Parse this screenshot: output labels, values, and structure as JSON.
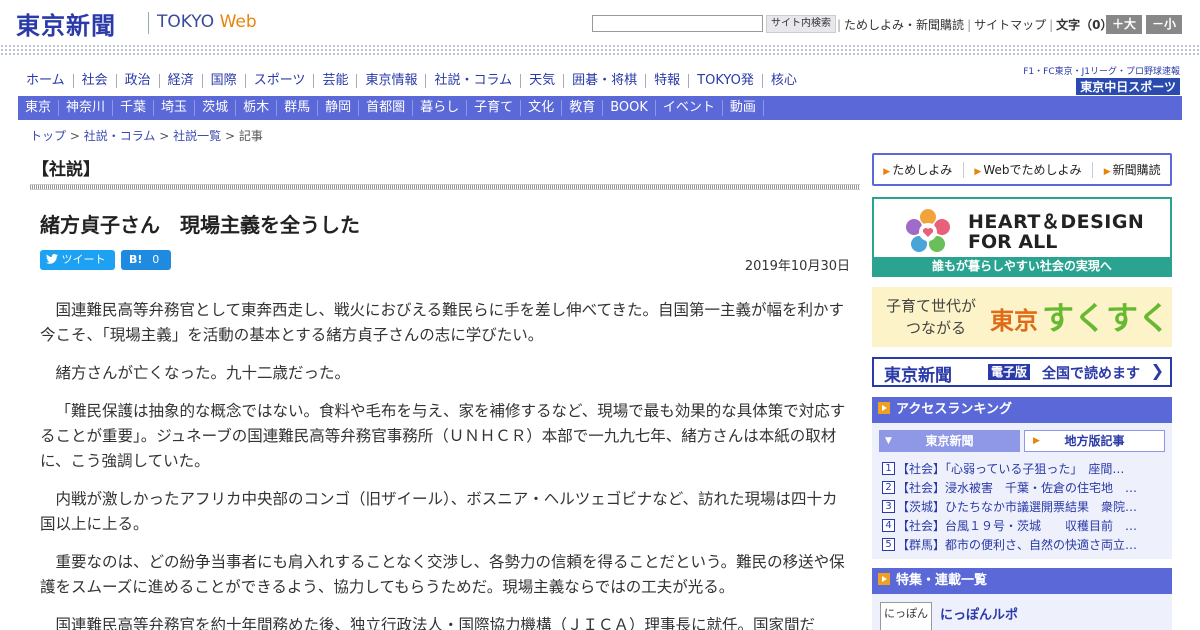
{
  "header": {
    "logo_jp": "東京新聞",
    "logo_en": "TOKYO",
    "logo_web": "Web",
    "search_button": "サイト内検索",
    "links": [
      "ためしよみ・新聞購読",
      "サイトマップ"
    ],
    "font_size_label": "文字（0）",
    "font_larger": "＋大",
    "font_smaller": "－小"
  },
  "main_nav": [
    "ホーム",
    "社会",
    "政治",
    "経済",
    "国際",
    "スポーツ",
    "芸能",
    "東京情報",
    "社説・コラム",
    "天気",
    "囲碁・将棋",
    "特報",
    "TOKYO発",
    "核心"
  ],
  "chunichi": {
    "line1": "F1・FC東京・J1リーグ・プロ野球速報",
    "line2": "東京中日スポーツ"
  },
  "sub_nav": [
    "東京",
    "神奈川",
    "千葉",
    "埼玉",
    "茨城",
    "栃木",
    "群馬",
    "静岡",
    "首都圏",
    "暮らし",
    "子育て",
    "文化",
    "教育",
    "BOOK",
    "イベント",
    "動画"
  ],
  "breadcrumb": {
    "items": [
      "トップ",
      "社説・コラム",
      "社説一覧"
    ],
    "current": "記事",
    "separator": ">"
  },
  "article": {
    "section": "【社説】",
    "headline": "緒方貞子さん　現場主義を全うした",
    "tweet_label": "ツイート",
    "hatena_label": "B!",
    "hatena_count": "0",
    "date": "2019年10月30日",
    "paragraphs": [
      "国連難民高等弁務官として東奔西走し、戦火におびえる難民らに手を差し伸べてきた。自国第一主義が幅を利かす今こそ、「現場主義」を活動の基本とする緒方貞子さんの志に学びたい。",
      "緒方さんが亡くなった。九十二歳だった。",
      "「難民保護は抽象的な概念ではない。食料や毛布を与え、家を補修するなど、現場で最も効果的な具体策で対応することが重要」。ジュネーブの国連難民高等弁務官事務所（ＵＮＨＣＲ）本部で一九九七年、緒方さんは本紙の取材に、こう強調していた。",
      "内戦が激しかったアフリカ中央部のコンゴ（旧ザイール）、ボスニア・ヘルツェゴビナなど、訪れた現場は四十カ国以上に上る。",
      "重要なのは、どの紛争当事者にも肩入れすることなく交渉し、各勢力の信頼を得ることだという。難民の移送や保護をスムーズに進めることができるよう、協力してもらうためだ。現場主義ならではの工夫が光る。",
      "国連難民高等弁務官を約十年間務めた後、独立行政法人・国際協力機構（ＪＩＣＡ）理事長に就任。国家間だ"
    ]
  },
  "sidebar": {
    "links": [
      "ためしよみ",
      "Webでためしよみ",
      "新聞購読"
    ],
    "heart_line1": "HEART＆DESIGN",
    "heart_line2": "FOR ALL",
    "heart_caption": "誰もが暮らしやすい社会の実現へ",
    "suku_line1": "子育て世代が",
    "suku_line2": "つながる",
    "suku_tokyo": "東京",
    "suku_main": "すくすく",
    "digital_title": "東京新聞",
    "digital_tag": "電子版",
    "digital_text": "全国で読めます",
    "ranking_title": "アクセスランキング",
    "ranking_tab1": "東京新聞",
    "ranking_tab2": "地方版記事",
    "ranking": [
      {
        "num": "1",
        "text": "【社会】「心弱っている子狙った」　座間…"
      },
      {
        "num": "2",
        "text": "【社会】浸水被害　千葉・佐倉の住宅地　…"
      },
      {
        "num": "3",
        "text": "【茨城】ひたちなか市議選開票結果　衆院…"
      },
      {
        "num": "4",
        "text": "【社会】台風１９号・茨城　　収穫目前　…"
      },
      {
        "num": "5",
        "text": "【群馬】都市の便利さ、自然の快適さ両立…"
      }
    ],
    "features_title": "特集・連載一覧",
    "feature_thumb": "にっぽん",
    "feature_title": "にっぽんルポ"
  },
  "colors": {
    "brand_blue": "#2a3aa8",
    "nav_blue": "#5a68d8",
    "accent_orange": "#e8840c",
    "heart_teal": "#2aa490"
  }
}
